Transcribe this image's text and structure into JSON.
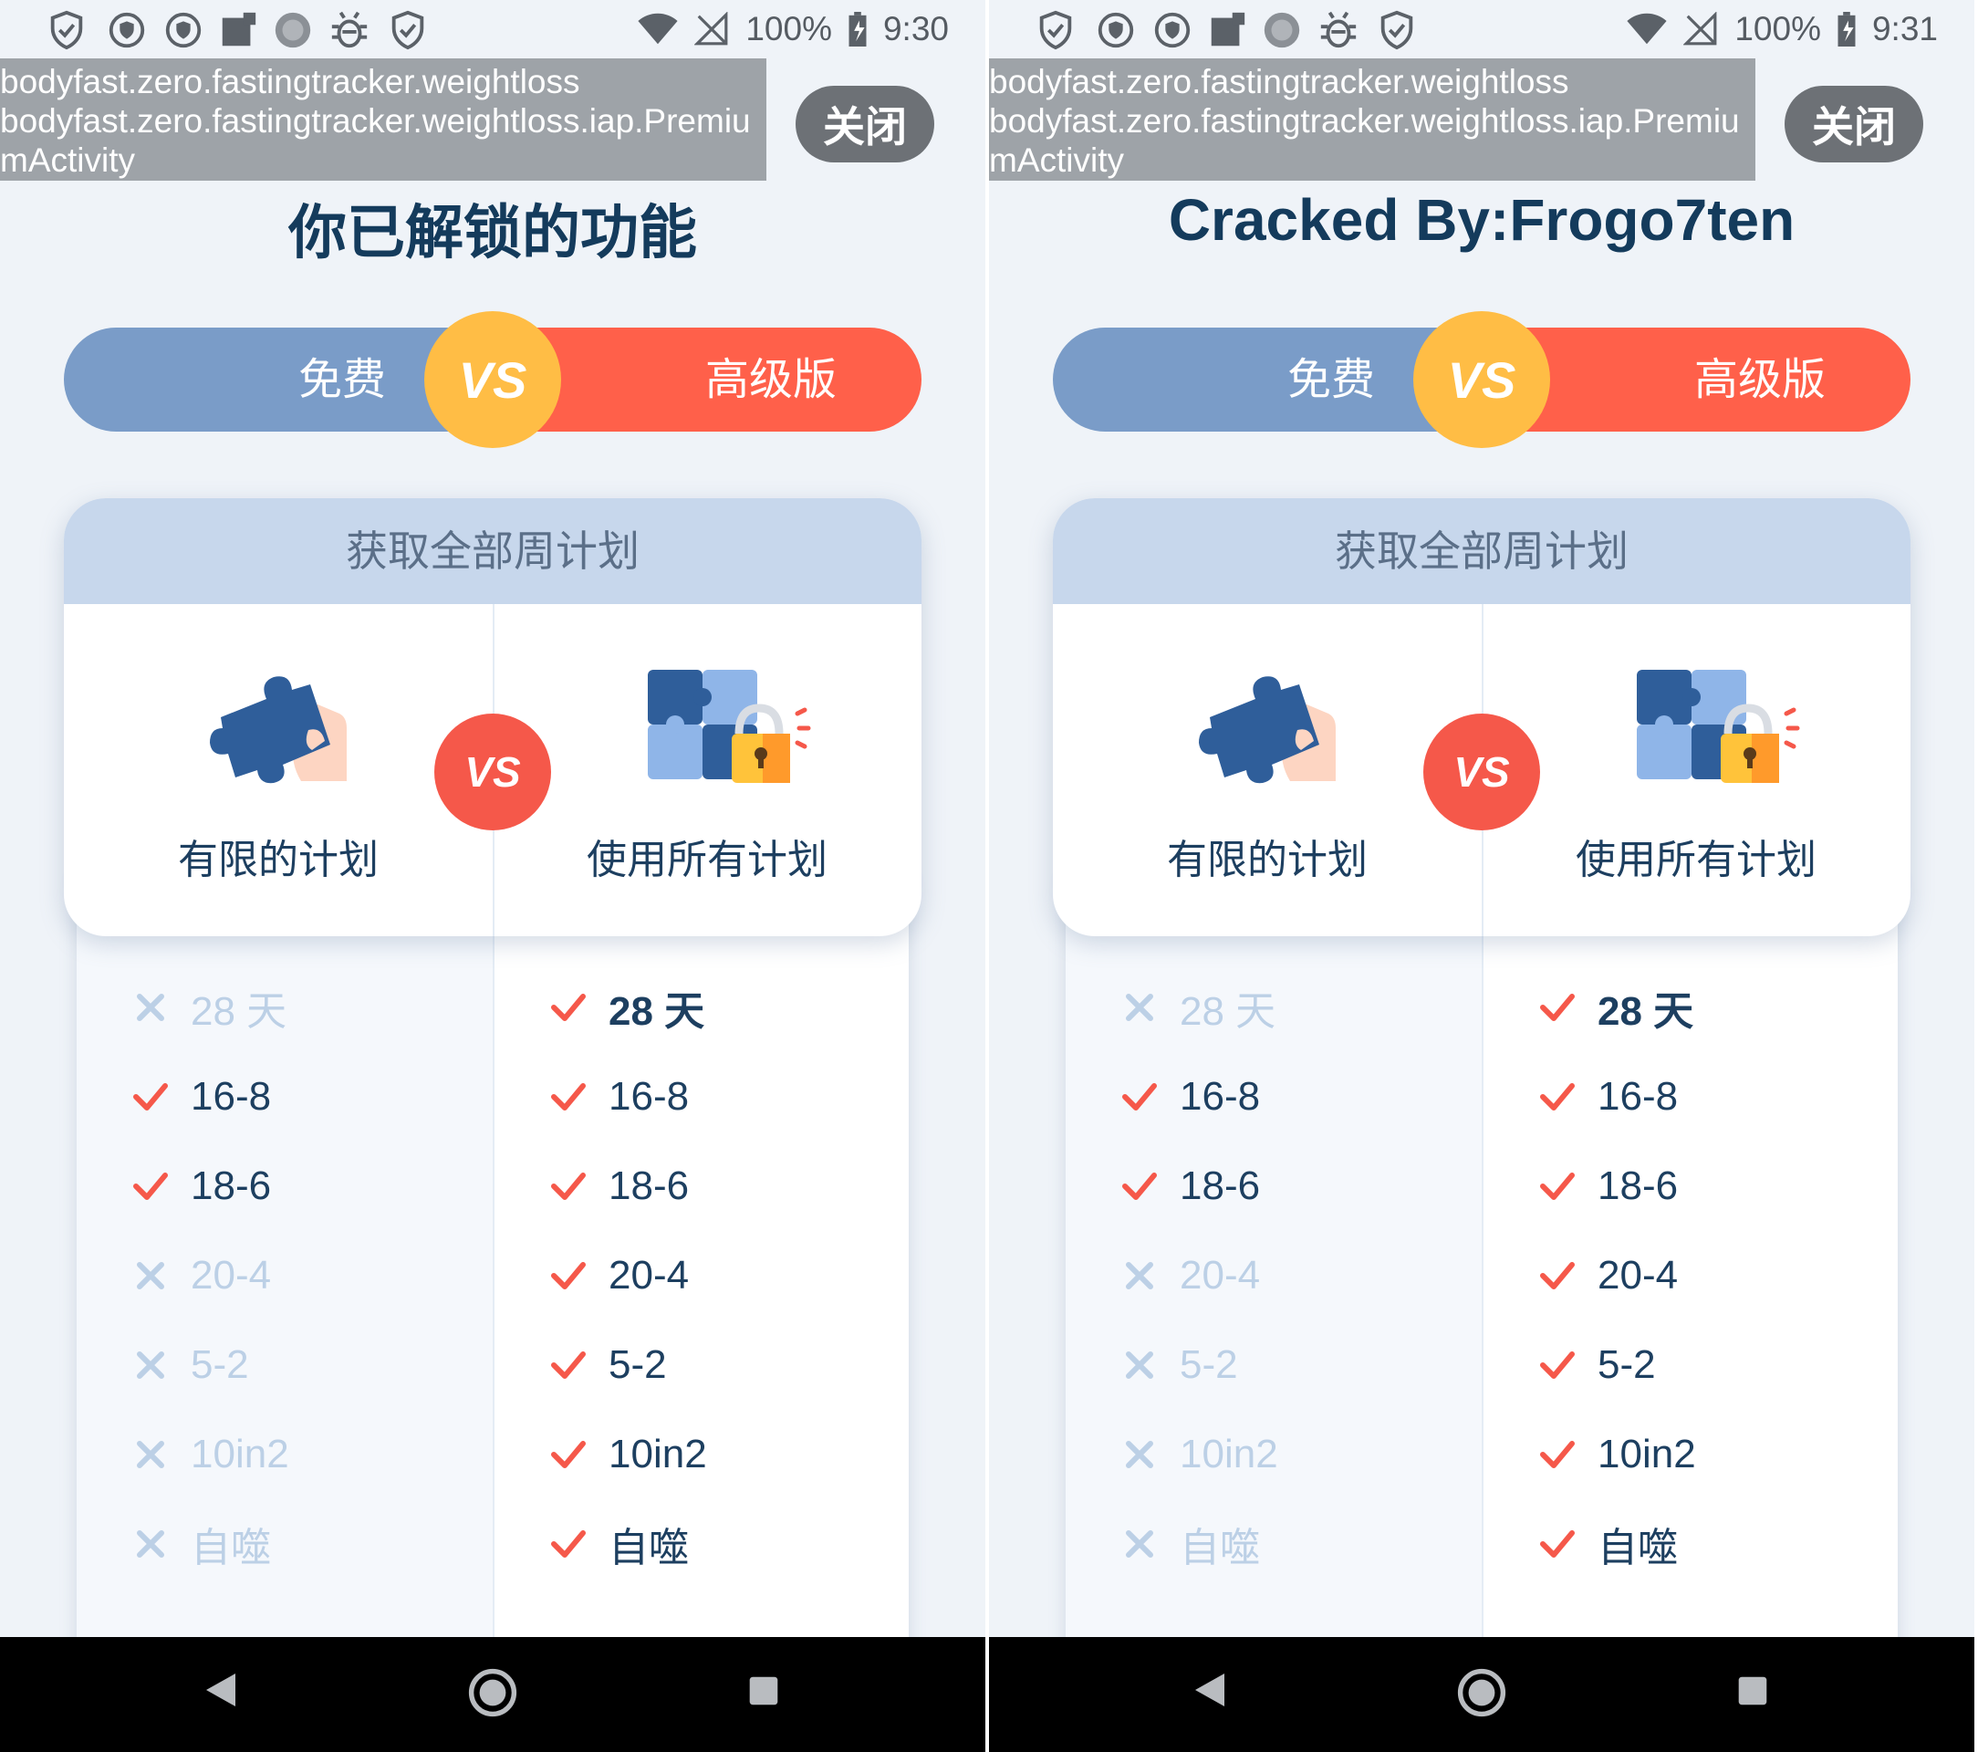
{
  "panels": [
    {
      "status": {
        "battery": "100%",
        "time": "9:30"
      },
      "activity": [
        "bodyfast.zero.fastingtracker.weightloss",
        "bodyfast.zero.fastingtracker.weightloss.iap.Premiu",
        "mActivity"
      ],
      "close_label": "关闭",
      "heading": "你已解锁的功能",
      "toggle": {
        "free": "免费",
        "vs": "VS",
        "premium": "高级版"
      },
      "card": {
        "title": "获取全部周计划",
        "vs": "VS",
        "left_label": "有限的计划",
        "right_label": "使用所有计划"
      },
      "free_features": [
        {
          "text": "28 天",
          "included": false
        },
        {
          "text": "16-8",
          "included": true
        },
        {
          "text": "18-6",
          "included": true
        },
        {
          "text": "20-4",
          "included": false
        },
        {
          "text": "5-2",
          "included": false
        },
        {
          "text": "10in2",
          "included": false
        },
        {
          "text": "自噬",
          "included": false
        }
      ],
      "premium_features": [
        {
          "text": "28 天",
          "included": true
        },
        {
          "text": "16-8",
          "included": true
        },
        {
          "text": "18-6",
          "included": true
        },
        {
          "text": "20-4",
          "included": true
        },
        {
          "text": "5-2",
          "included": true
        },
        {
          "text": "10in2",
          "included": true
        },
        {
          "text": "自噬",
          "included": true
        }
      ]
    },
    {
      "status": {
        "battery": "100%",
        "time": "9:31"
      },
      "activity": [
        "bodyfast.zero.fastingtracker.weightloss",
        "bodyfast.zero.fastingtracker.weightloss.iap.Premiu",
        "mActivity"
      ],
      "close_label": "关闭",
      "heading": "Cracked By:Frogo7ten",
      "toggle": {
        "free": "免费",
        "vs": "VS",
        "premium": "高级版"
      },
      "card": {
        "title": "获取全部周计划",
        "vs": "VS",
        "left_label": "有限的计划",
        "right_label": "使用所有计划"
      },
      "free_features": [
        {
          "text": "28 天",
          "included": false
        },
        {
          "text": "16-8",
          "included": true
        },
        {
          "text": "18-6",
          "included": true
        },
        {
          "text": "20-4",
          "included": false
        },
        {
          "text": "5-2",
          "included": false
        },
        {
          "text": "10in2",
          "included": false
        },
        {
          "text": "自噬",
          "included": false
        }
      ],
      "premium_features": [
        {
          "text": "28 天",
          "included": true
        },
        {
          "text": "16-8",
          "included": true
        },
        {
          "text": "18-6",
          "included": true
        },
        {
          "text": "20-4",
          "included": true
        },
        {
          "text": "5-2",
          "included": true
        },
        {
          "text": "10in2",
          "included": true
        },
        {
          "text": "自噬",
          "included": true
        }
      ]
    }
  ],
  "icons": {
    "status_left": [
      "shield-check-icon",
      "vpn-shield-icon",
      "vpn-shield-icon",
      "square-app-icon",
      "loading-circle-icon",
      "bug-icon",
      "shield-check-icon"
    ],
    "included": "check-icon",
    "excluded": "cross-icon",
    "nav": [
      "back-icon",
      "home-icon",
      "recents-icon"
    ]
  },
  "colors": {
    "free": "#7a9cc8",
    "premium": "#ff604a",
    "vs_coin": "#ffbd45",
    "check": "#f5584a",
    "cross": "#bcd0e6",
    "heading": "#143b5c"
  }
}
